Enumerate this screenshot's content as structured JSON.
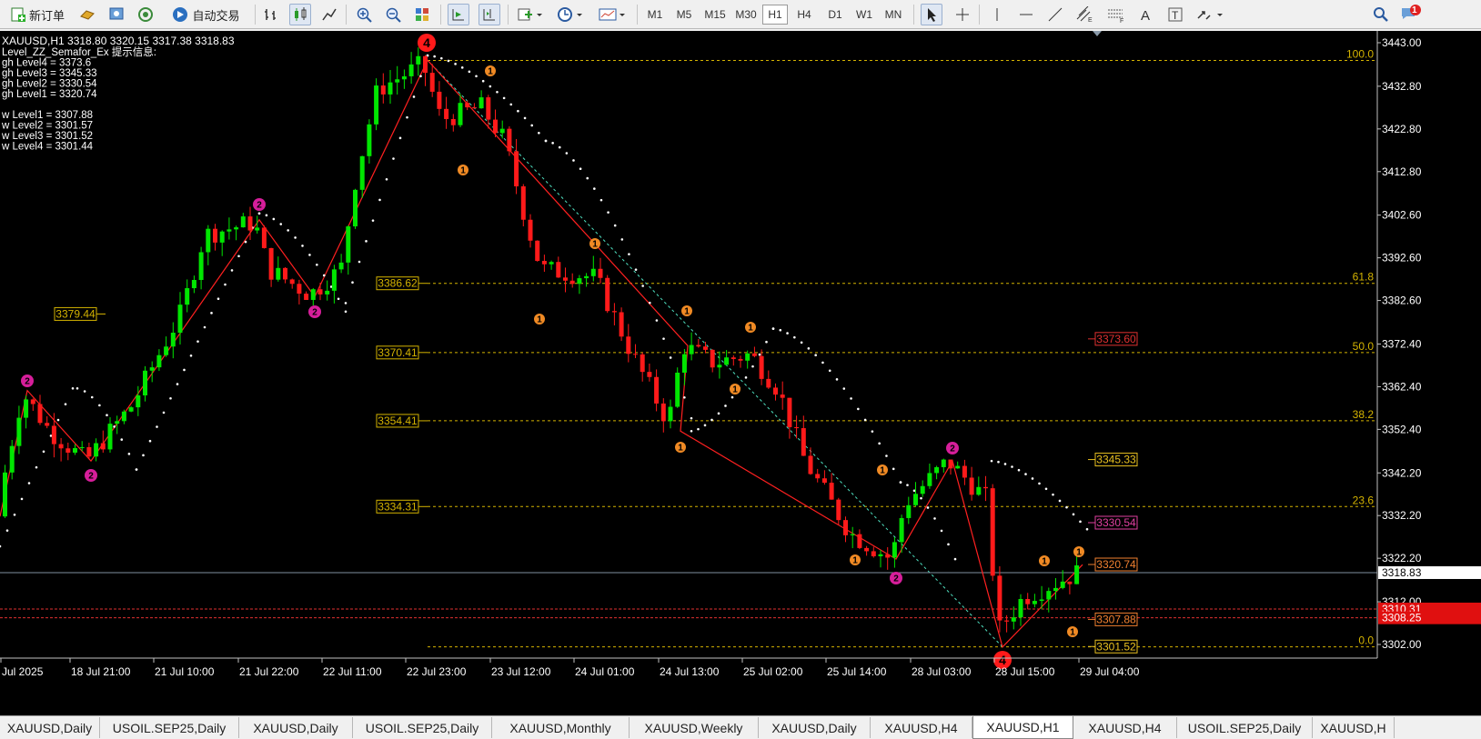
{
  "toolbar": {
    "new_order_label": "新订单",
    "auto_trade_label": "自动交易",
    "timeframes": [
      "M1",
      "M5",
      "M15",
      "M30",
      "H1",
      "H4",
      "D1",
      "W1",
      "MN"
    ],
    "active_timeframe": "H1",
    "notification_count": "1"
  },
  "chart": {
    "header": "XAUUSD,H1  3318.80 3320.15 3317.38 3318.83",
    "info_lines": [
      "Level_ZZ_Semafor_Ex 提示信息:",
      "gh Level4 = 3373.6",
      "gh Level3 = 3345.33",
      "gh Level2 = 3330.54",
      "gh Level1 = 3320.74",
      "",
      "w Level1 = 3307.88",
      "w Level2 = 3301.57",
      "w Level3 = 3301.52",
      "w Level4 = 3301.44"
    ],
    "price_axis": [
      "3443.00",
      "3432.80",
      "3422.80",
      "3412.80",
      "3402.60",
      "3392.60",
      "3382.60",
      "3372.40",
      "3362.40",
      "3352.40",
      "3342.20",
      "3332.20",
      "3322.20",
      "3312.00",
      "3302.00"
    ],
    "current_price": "3318.83",
    "ask_price": "3310.31",
    "bid_price": "3308.25",
    "time_axis": [
      "Jul 2025",
      "18 Jul 21:00",
      "21 Jul 10:00",
      "21 Jul 22:00",
      "22 Jul 11:00",
      "22 Jul 23:00",
      "23 Jul 12:00",
      "24 Jul 01:00",
      "24 Jul 13:00",
      "25 Jul 02:00",
      "25 Jul 14:00",
      "28 Jul 03:00",
      "28 Jul 15:00",
      "29 Jul 04:00"
    ],
    "fib_levels": [
      {
        "label": "100.0",
        "value": 3438.85
      },
      {
        "label": "61.8",
        "value": 3386.62
      },
      {
        "label": "50.0",
        "value": 3370.41
      },
      {
        "label": "38.2",
        "value": 3354.41
      },
      {
        "label": "23.6",
        "value": 3334.31
      },
      {
        "label": "0.0",
        "value": 3301.44
      }
    ],
    "left_labels": [
      "3379.44",
      "3386.62",
      "3370.41",
      "3354.41",
      "3334.31"
    ],
    "right_levels": [
      {
        "text": "3373.60",
        "color": "#e03030"
      },
      {
        "text": "3345.33",
        "color": "#e8c020"
      },
      {
        "text": "3330.54",
        "color": "#e040a0"
      },
      {
        "text": "3320.74",
        "color": "#f08030"
      },
      {
        "text": "3307.88",
        "color": "#f08030"
      },
      {
        "text": "3301.52",
        "color": "#e8c020"
      }
    ],
    "markers": [
      {
        "n": "4"
      },
      {
        "n": "2"
      },
      {
        "n": "2"
      },
      {
        "n": "2"
      },
      {
        "n": "2"
      },
      {
        "n": "1"
      },
      {
        "n": "1"
      },
      {
        "n": "1"
      },
      {
        "n": "1"
      },
      {
        "n": "1"
      },
      {
        "n": "1"
      },
      {
        "n": "1"
      },
      {
        "n": "1"
      },
      {
        "n": "1"
      },
      {
        "n": "1"
      },
      {
        "n": "1"
      },
      {
        "n": "1"
      },
      {
        "n": "1"
      },
      {
        "n": "2"
      },
      {
        "n": "2"
      },
      {
        "n": "4"
      }
    ]
  },
  "colors": {
    "bull": "#00e600",
    "bear": "#ff1a1a",
    "fib": "#d4b300",
    "label_bg": "#000",
    "semafor1": "#f08a24",
    "semafor2": "#d61e9a",
    "semafor4": "#ff1a1a"
  },
  "tabs": [
    "XAUUSD,Daily",
    "USOIL.SEP25,Daily",
    "XAUUSD,Daily",
    "USOIL.SEP25,Daily",
    "XAUUSD,Monthly",
    "XAUUSD,Weekly",
    "XAUUSD,Daily",
    "XAUUSD,H4",
    "XAUUSD,H1",
    "XAUUSD,H4",
    "USOIL.SEP25,Daily",
    "XAUUSD,H"
  ],
  "active_tab": "XAUUSD,H1"
}
